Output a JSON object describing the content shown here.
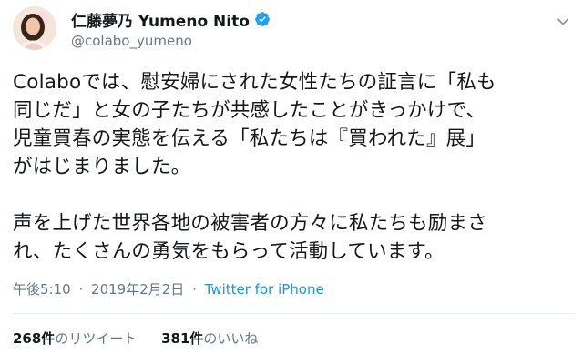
{
  "author": {
    "display_name": "仁藤夢乃 Yumeno Nito",
    "handle": "@colabo_yumeno",
    "verified": true,
    "verified_icon": "verified-badge-icon",
    "avatar": "profile-photo-avatar"
  },
  "menu_icon": "chevron-down-icon",
  "tweet": {
    "text": "Colaboでは、慰安婦にされた女性たちの証言に「私も\n同じだ」と女の子たちが共感したことがきっかけで、\n児童買春の実態を伝える「私たちは『買われた』展」\nがはじまりました。\n\n声を上げた世界各地の被害者の方々に私たちも励まさ\nれ、たくさんの勇気をもらって活動しています。"
  },
  "meta": {
    "time": "午後5:10",
    "separator": "·",
    "date": "2019年2月2日",
    "source": "Twitter for iPhone"
  },
  "stats": {
    "retweets_count": "268件",
    "retweets_label": "のリツイート",
    "likes_count": "381件",
    "likes_label": "のいいね"
  },
  "colors": {
    "text": "#14171a",
    "secondary": "#657786",
    "link": "#1b95e0",
    "verified": "#1da1f2",
    "divider": "#e6ecf0"
  }
}
